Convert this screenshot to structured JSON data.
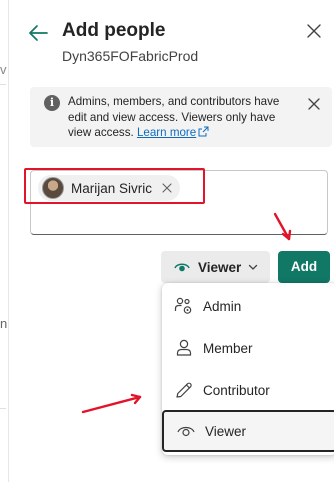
{
  "background": {
    "fragment_v": "v",
    "fragment_n": "n"
  },
  "panel": {
    "title": "Add people",
    "subtitle": "Dyn365FOFabricProd",
    "back_icon": "arrow-left-icon",
    "close_icon": "close-icon"
  },
  "info": {
    "text": "Admins, members, and contributors have edit and view access. Viewers only have view access.",
    "link_label": "Learn more",
    "icon": "info-icon"
  },
  "people_input": {
    "chips": [
      {
        "name": "Marijan Sivric"
      }
    ]
  },
  "role_button": {
    "label": "Viewer",
    "icon": "eye-icon"
  },
  "add_button": {
    "label": "Add"
  },
  "role_menu": {
    "items": [
      {
        "label": "Admin",
        "icon": "people-settings-icon"
      },
      {
        "label": "Member",
        "icon": "person-icon"
      },
      {
        "label": "Contributor",
        "icon": "pencil-icon"
      },
      {
        "label": "Viewer",
        "icon": "eye-icon"
      }
    ],
    "selected": "Viewer"
  },
  "colors": {
    "accent": "#117865",
    "link": "#0f6cbd",
    "annotation": "#e2142b",
    "info_bg": "#f3f3f3"
  }
}
